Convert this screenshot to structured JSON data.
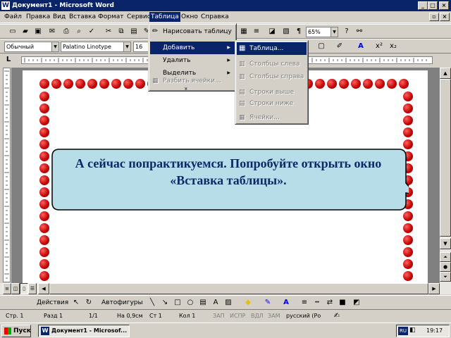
{
  "window": {
    "title": "Документ1 - Microsoft Word"
  },
  "menubar": {
    "items": [
      "Файл",
      "Правка",
      "Вид",
      "Вставка",
      "Формат",
      "Сервис",
      "Таблица",
      "Окно",
      "Справка"
    ]
  },
  "toolbar": {
    "zoom": "65%"
  },
  "format": {
    "style": "Обычный",
    "font": "Palatino Linotype",
    "size": "16"
  },
  "table_menu": {
    "draw": "Нарисовать таблицу",
    "add": "Добавить",
    "delete": "Удалить",
    "select": "Выделить",
    "split": "Разбить ячейки...",
    "more": "»"
  },
  "add_submenu": {
    "table": "Таблица...",
    "cols_left": "Столбцы слева",
    "cols_right": "Столбцы справа",
    "rows_above": "Строки выше",
    "rows_below": "Строки ниже",
    "cells": "Ячейки..."
  },
  "callout": {
    "text": "А сейчас попрактикуемся. Попробуйте открыть окно «Вставка таблицы»."
  },
  "drawing": {
    "actions": "Действия",
    "autoshapes": "Автофигуры"
  },
  "status": {
    "page": "Стр. 1",
    "section": "Разд 1",
    "pages": "1/1",
    "at": "На 0,9см",
    "line": "Ст 1",
    "col": "Кол 1",
    "rec": "ЗАП",
    "trk": "ИСПР",
    "ext": "ВДЛ",
    "ovr": "ЗАМ",
    "lang": "русский (Ро"
  },
  "taskbar": {
    "start": "Пуск",
    "task": "Документ1 - Microsof...",
    "lang": "RU",
    "clock": "19:17"
  },
  "colors": {
    "titlebar": "#0a246a",
    "chrome": "#d4d0c8",
    "callout_fill": "#b7dde8",
    "apple": "#c00000"
  }
}
